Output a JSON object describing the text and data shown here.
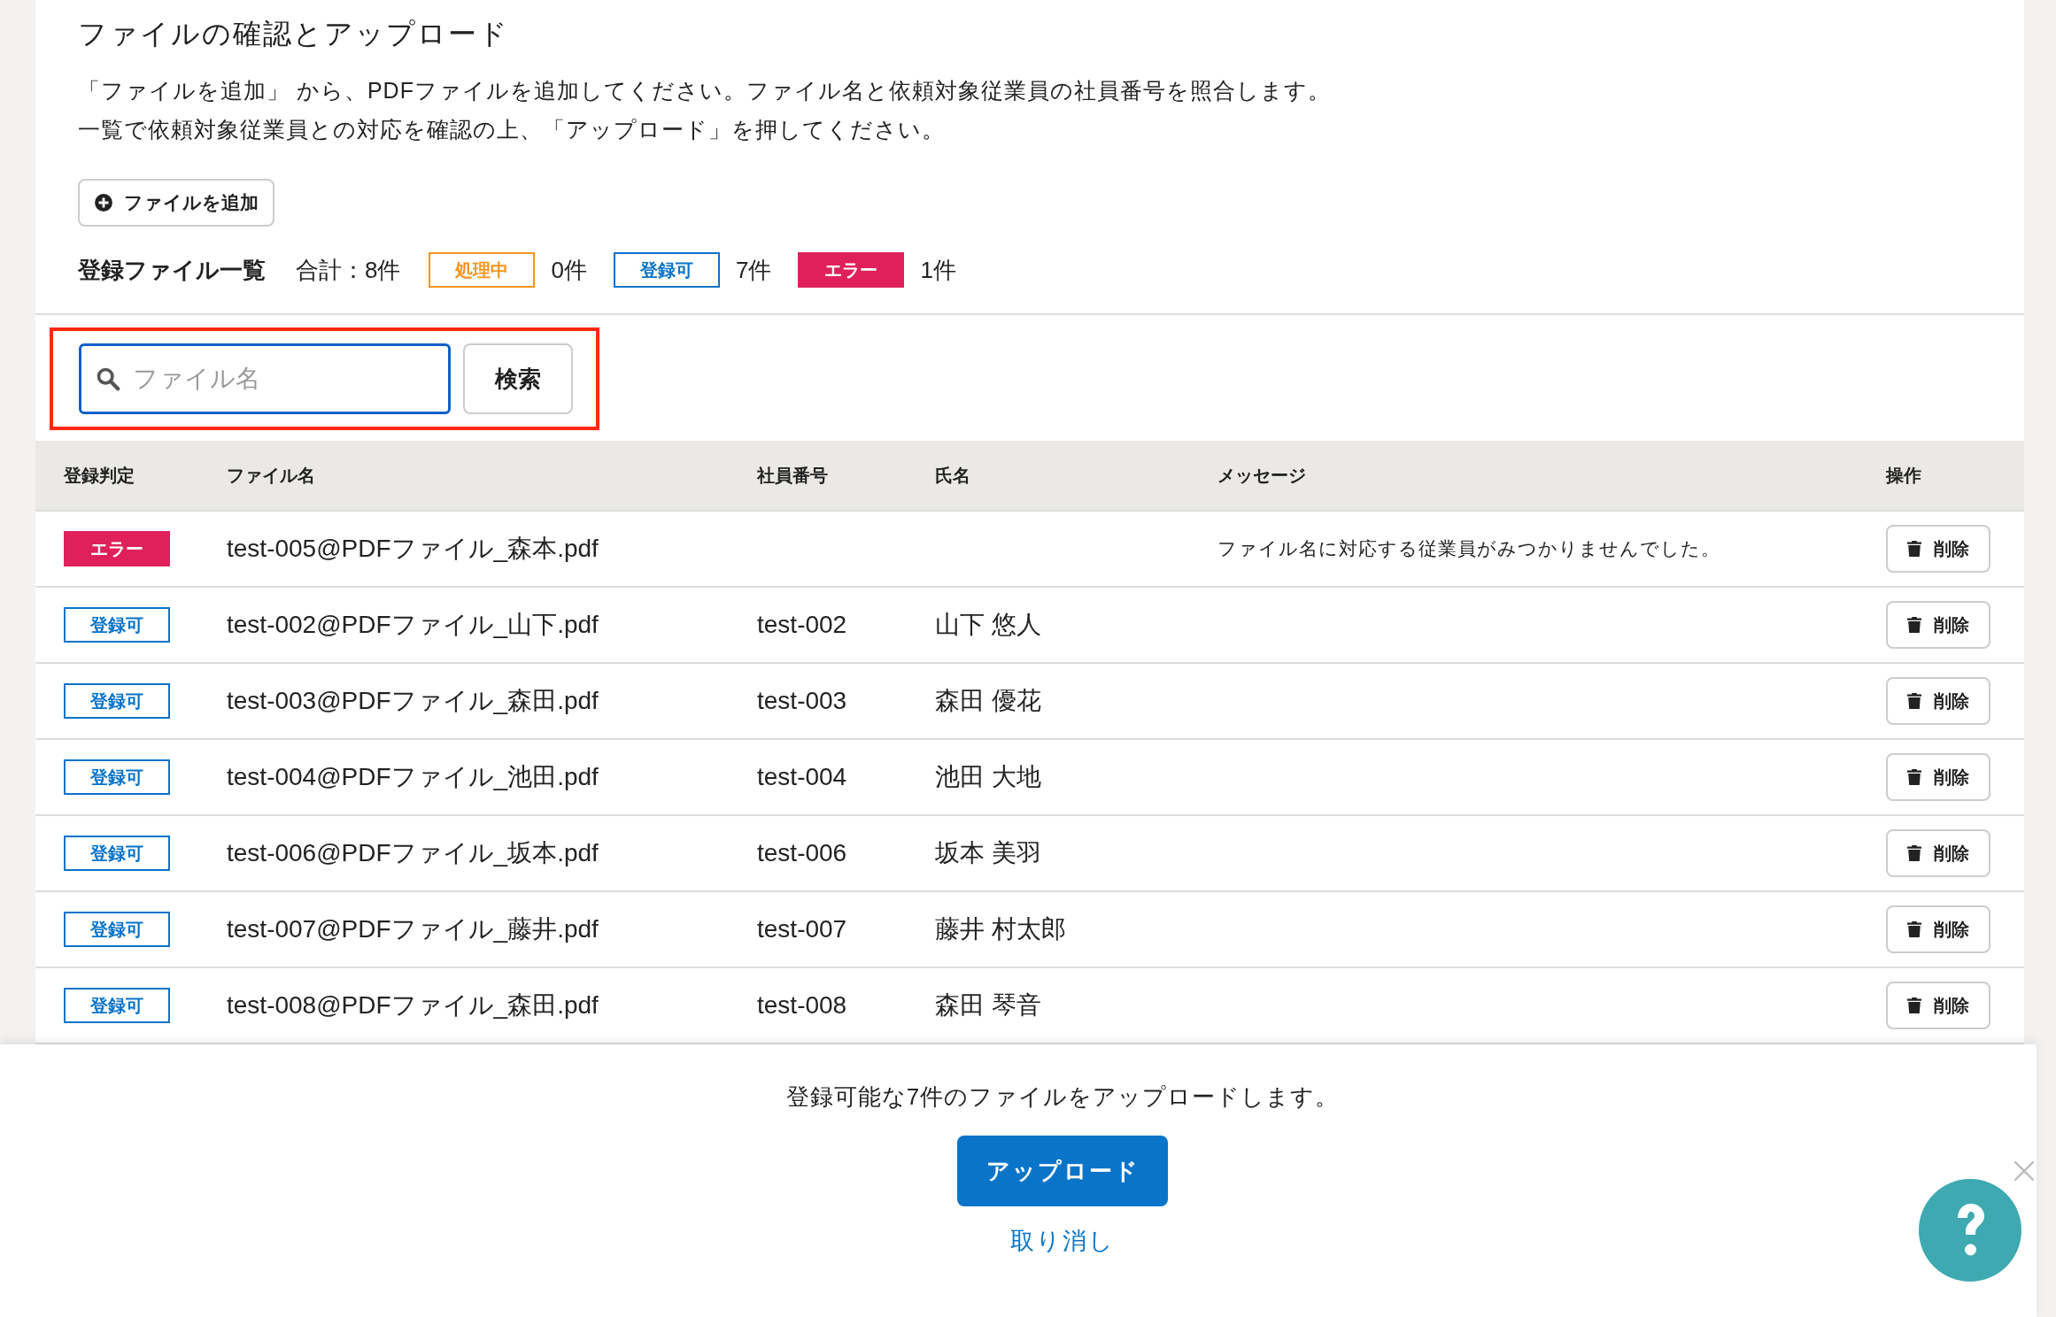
{
  "title": "ファイルの確認とアップロード",
  "description": [
    "「ファイルを追加」 から、PDFファイルを追加してください。ファイル名と依頼対象従業員の社員番号を照合します。",
    "一覧で依頼対象従業員との対応を確認の上、「アップロード」を押してください。"
  ],
  "add_button": "ファイルを追加",
  "summary": {
    "heading": "登録ファイル一覧",
    "total": "合計：8件",
    "counts": [
      {
        "kind": "processing",
        "label": "処理中",
        "count": "0件"
      },
      {
        "kind": "ok",
        "label": "登録可",
        "count": "7件"
      },
      {
        "kind": "error",
        "label": "エラー",
        "count": "1件"
      }
    ]
  },
  "search": {
    "placeholder": "ファイル名",
    "button": "検索",
    "highlighted": true
  },
  "table": {
    "columns": [
      "登録判定",
      "ファイル名",
      "社員番号",
      "氏名",
      "メッセージ",
      "操作"
    ],
    "rows": [
      {
        "kind": "error",
        "status": "エラー",
        "file": "test-005@PDFファイル_森本.pdf",
        "message": "ファイル名に対応する従業員がみつかりませんでした。",
        "action": "削除"
      },
      {
        "kind": "ok",
        "status": "登録可",
        "file": "test-002@PDFファイル_山下.pdf",
        "employee_no": "test-002",
        "name": "山下 悠人",
        "action": "削除"
      },
      {
        "kind": "ok",
        "status": "登録可",
        "file": "test-003@PDFファイル_森田.pdf",
        "employee_no": "test-003",
        "name": "森田 優花",
        "action": "削除"
      },
      {
        "kind": "ok",
        "status": "登録可",
        "file": "test-004@PDFファイル_池田.pdf",
        "employee_no": "test-004",
        "name": "池田 大地",
        "action": "削除"
      },
      {
        "kind": "ok",
        "status": "登録可",
        "file": "test-006@PDFファイル_坂本.pdf",
        "employee_no": "test-006",
        "name": "坂本 美羽",
        "action": "削除"
      },
      {
        "kind": "ok",
        "status": "登録可",
        "file": "test-007@PDFファイル_藤井.pdf",
        "employee_no": "test-007",
        "name": "藤井 村太郎",
        "action": "削除"
      },
      {
        "kind": "ok",
        "status": "登録可",
        "file": "test-008@PDFファイル_森田.pdf",
        "employee_no": "test-008",
        "name": "森田 琴音",
        "action": "削除"
      }
    ]
  },
  "footer": {
    "note": "登録可能な7件のファイルをアップロードします。",
    "upload_button": "アップロード",
    "cancel_link": "取り消し"
  }
}
